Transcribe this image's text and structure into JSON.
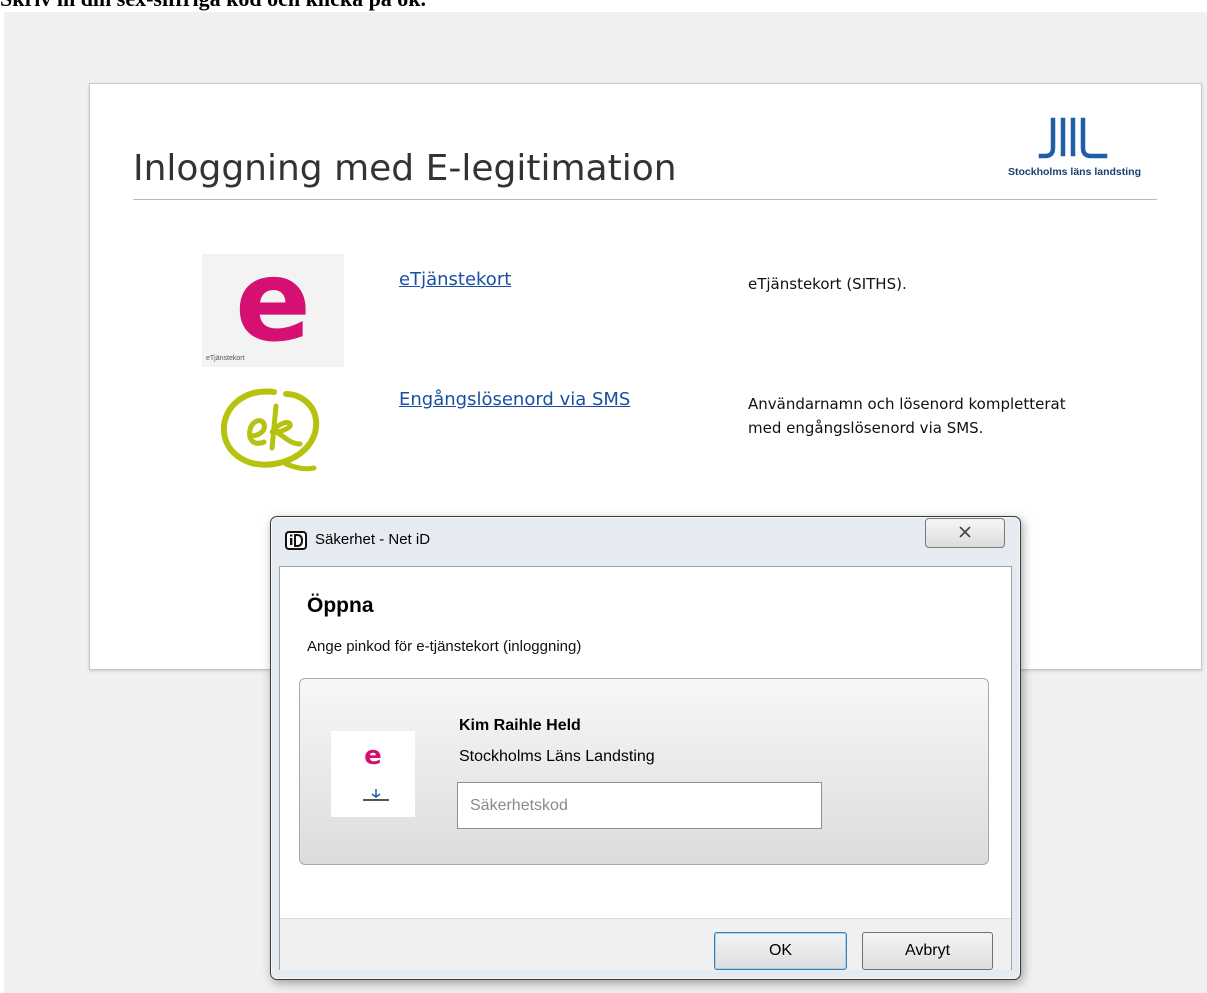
{
  "instruction": "Skriv in din sex-siffriga kod och klicka på ok.",
  "page": {
    "title": "Inloggning med E-legitimation",
    "logo_text": "Stockholms läns landsting",
    "methods": [
      {
        "icon": "etjanstekort-logo",
        "icon_caption": "eTjänstekort",
        "link": "eTjänstekort",
        "description": "eTjänstekort (SITHS)."
      },
      {
        "icon": "ek-logo",
        "link": "Engångslösenord via SMS",
        "description": "Användarnamn och lösenord kompletterat med engångslösenord via SMS."
      }
    ]
  },
  "dialog": {
    "title": "Säkerhet - Net iD",
    "heading": "Öppna",
    "subtitle": "Ange pinkod för e-tjänstekort (inloggning)",
    "card": {
      "name": "Kim Raihle Held",
      "organization": "Stockholms Läns Landsting",
      "pin_placeholder": "Säkerhetskod",
      "pin_value": ""
    },
    "buttons": {
      "ok": "OK",
      "cancel": "Avbryt"
    }
  },
  "colors": {
    "link": "#1a4fa0",
    "etjanst_pink": "#d60f73",
    "ek_green": "#b6c20e",
    "sll_blue": "#1b3e70"
  }
}
